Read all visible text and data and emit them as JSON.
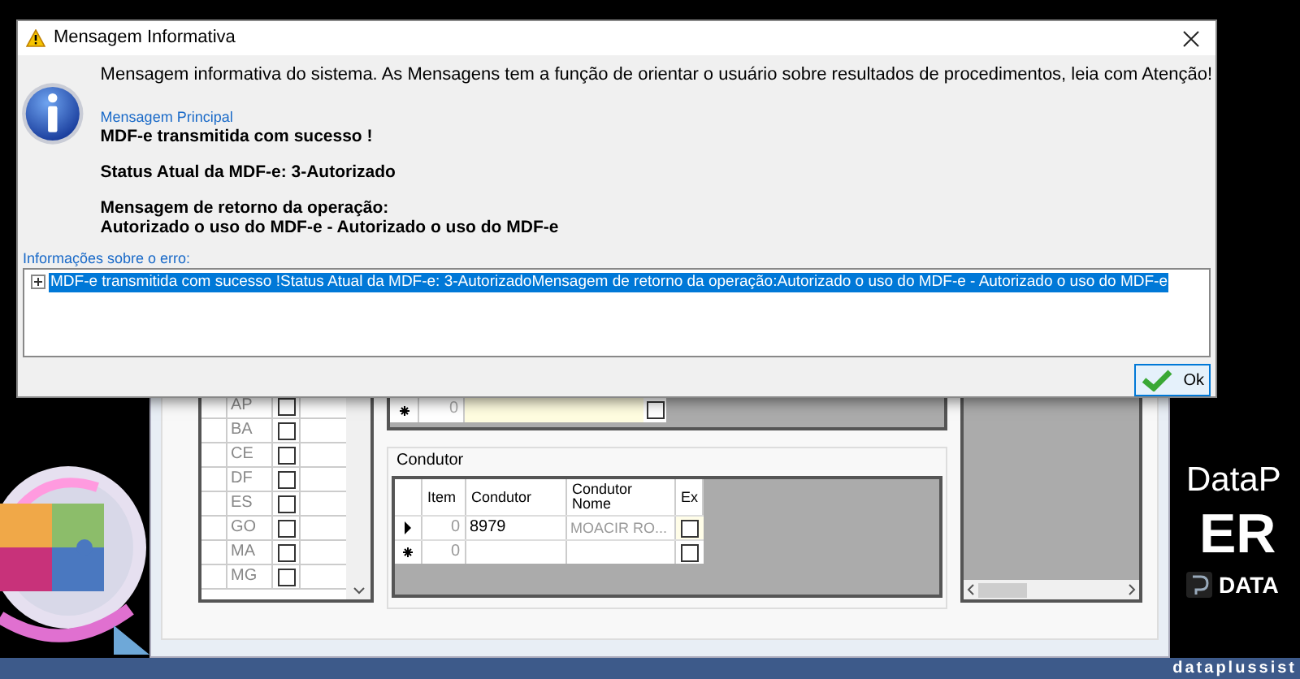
{
  "desktop": {
    "brand_line_1": "DataP",
    "brand_line_2": "ER",
    "brand_logo_text": "DATA",
    "taskbar_text": "dataplussist"
  },
  "background_window": {
    "uf_list": [
      {
        "uf": "AP",
        "checked": false
      },
      {
        "uf": "BA",
        "checked": false
      },
      {
        "uf": "CE",
        "checked": false
      },
      {
        "uf": "DF",
        "checked": false
      },
      {
        "uf": "ES",
        "checked": false
      },
      {
        "uf": "GO",
        "checked": false
      },
      {
        "uf": "MA",
        "checked": false
      },
      {
        "uf": "MG",
        "checked": false
      }
    ],
    "top_grid": {
      "rows": [
        {
          "kind": "new",
          "item": "0",
          "checked": false
        }
      ]
    },
    "condutor": {
      "title": "Condutor",
      "columns": [
        "Item",
        "Condutor",
        "Condutor Nome",
        "Ex"
      ],
      "rows": [
        {
          "kind": "current",
          "item": "0",
          "condutor": "8979",
          "nome": "MOACIR RO...",
          "ex": false
        },
        {
          "kind": "new",
          "item": "0",
          "ex": false
        }
      ]
    }
  },
  "dialog": {
    "title": "Mensagem Informativa",
    "intro": "Mensagem informativa do sistema. As Mensagens tem a função de orientar o usuário sobre resultados de procedimentos, leia com Atenção!",
    "principal_label": "Mensagem Principal",
    "lines": [
      "MDF-e transmitida com sucesso !",
      "Status Atual da MDF-e: 3-Autorizado"
    ],
    "return_label": "Mensagem de retorno da operação:",
    "return_text": "Autorizado o uso do MDF-e - Autorizado o uso do MDF-e",
    "details_label": "Informações sobre o erro:",
    "details": [
      {
        "text": "MDF-e transmitida com sucesso !Status Atual da MDF-e: 3-AutorizadoMensagem de retorno da operação:Autorizado o uso do MDF-e - Autorizado o uso do MDF-e",
        "selected": true,
        "expanded": false
      }
    ],
    "ok_button": "Ok"
  }
}
